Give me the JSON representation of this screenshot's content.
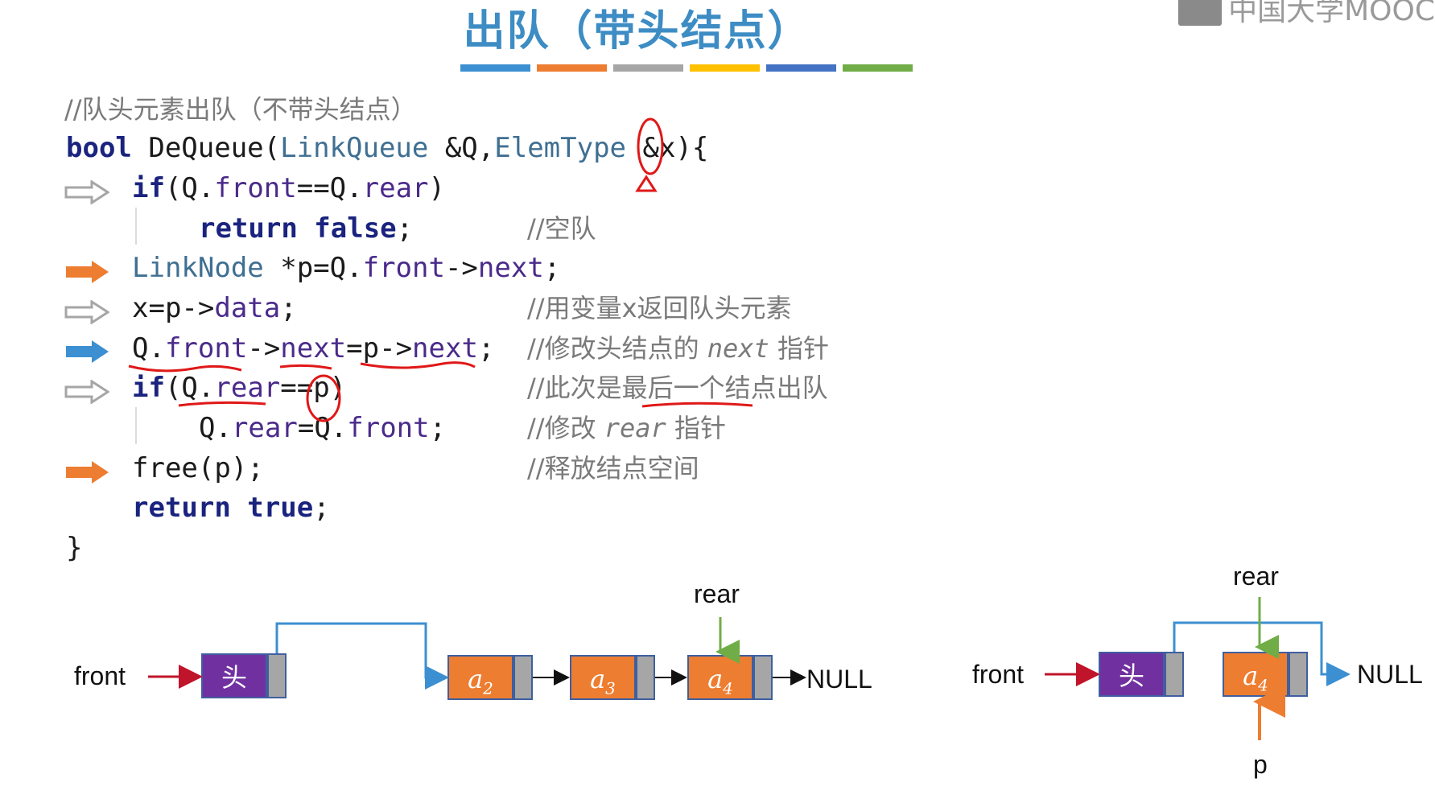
{
  "slide": {
    "title": "出队（带头结点）",
    "watermark": "中国大学MOOC",
    "accent_colors": [
      "#3c8fd0",
      "#ed7d31",
      "#a6a6a6",
      "#ffc000",
      "#4472c4",
      "#70ad47"
    ]
  },
  "code": {
    "comment_line": "//队头元素出队（不带头结点）",
    "lines": {
      "l1_kw": "bool",
      "l1_rest_a": " DeQueue(",
      "l1_type1": "LinkQueue",
      "l1_rest_b": " &Q,",
      "l1_type2": "ElemType",
      "l1_rest_c": " &x){",
      "l2_kw": "if",
      "l2_a": "(Q.",
      "l2_fld1": "front",
      "l2_b": "==Q.",
      "l2_fld2": "rear",
      "l2_c": ")",
      "l3_kw1": "return",
      "l3_kw2": " false",
      "l3_c": ";",
      "l3_comment": "//空队",
      "l4_ty": "LinkNode",
      "l4_a": " *p=Q.",
      "l4_fld1": "front",
      "l4_b": "->",
      "l4_fld2": "next",
      "l4_c": ";",
      "l5_a": "x=p->",
      "l5_fld": "data",
      "l5_b": ";",
      "l5_comment": "//用变量x返回队头元素",
      "l6_a": "Q.",
      "l6_fld1": "front",
      "l6_b": "->",
      "l6_fld2": "next",
      "l6_c": "=p->",
      "l6_fld3": "next",
      "l6_d": ";",
      "l6_comment_a": "//修改头结点的 ",
      "l6_comment_i": "next",
      "l6_comment_b": " 指针",
      "l7_kw": "if",
      "l7_a": "(Q.",
      "l7_fld": "rear",
      "l7_b": "==p)",
      "l7_comment": "//此次是最后一个结点出队",
      "l8_a": "Q.",
      "l8_fld1": "rear",
      "l8_b": "=Q.",
      "l8_fld2": "front",
      "l8_c": ";",
      "l8_comment_a": "//修改 ",
      "l8_comment_i": "rear",
      "l8_comment_b": " 指针",
      "l9_a": "free(p);",
      "l9_comment": "//释放结点空间",
      "l10_kw1": "return",
      "l10_kw2": " true",
      "l10_c": ";",
      "l11": "}"
    },
    "step_arrow_states": [
      "outline",
      "outline",
      "orange",
      "outline",
      "blue",
      "outline",
      "orange"
    ]
  },
  "diagram1": {
    "front_label": "front",
    "rear_label": "rear",
    "head_label": "头",
    "nodes": [
      {
        "letter": "a",
        "sub": "2"
      },
      {
        "letter": "a",
        "sub": "3"
      },
      {
        "letter": "a",
        "sub": "4"
      }
    ],
    "null_label": "NULL"
  },
  "diagram2": {
    "front_label": "front",
    "rear_label": "rear",
    "head_label": "头",
    "node": {
      "letter": "a",
      "sub": "4"
    },
    "null_label": "NULL",
    "p_label": "p"
  }
}
